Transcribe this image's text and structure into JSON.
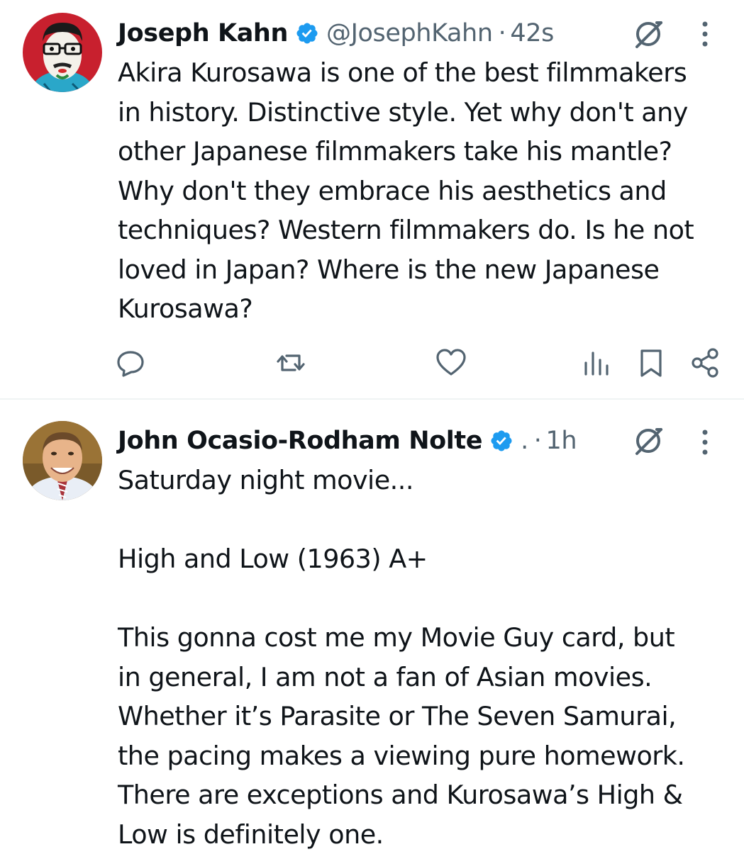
{
  "tweets": [
    {
      "author_name": "Joseph Kahn",
      "handle": "@JosephKahn",
      "separator": "·",
      "time": "42s",
      "text": "Akira Kurosawa is one of the best filmmakers\nin history. Distinctive style. Yet why don't any\nother Japanese filmmakers take his mantle?\nWhy don't they embrace his aesthetics and\ntechniques? Western filmmakers do. Is he not\nloved in Japan? Where is the new Japanese\nKurosawa?",
      "verified": true,
      "actions": [
        "reply-icon",
        "retweet-icon",
        "like-icon",
        "views-icon",
        "bookmark-icon",
        "share-icon"
      ]
    },
    {
      "author_name": "John Ocasio-Rodham Nolte",
      "handle": ".",
      "separator": "·",
      "time": "1h",
      "text": "Saturday night movie...\n\nHigh and Low (1963) A+\n\nThis gonna cost me my Movie Guy card, but\nin general, I am not a fan of Asian movies.\nWhether it’s Parasite or The Seven Samurai,\nthe pacing makes a viewing pure homework.\nThere are exceptions and Kurosawa’s High &\nLow is definitely one.",
      "verified": true
    }
  ],
  "colors": {
    "text": "#0f1419",
    "secondary": "#536471",
    "verified_blue": "#1d9bf0",
    "divider": "#eff3f4"
  }
}
